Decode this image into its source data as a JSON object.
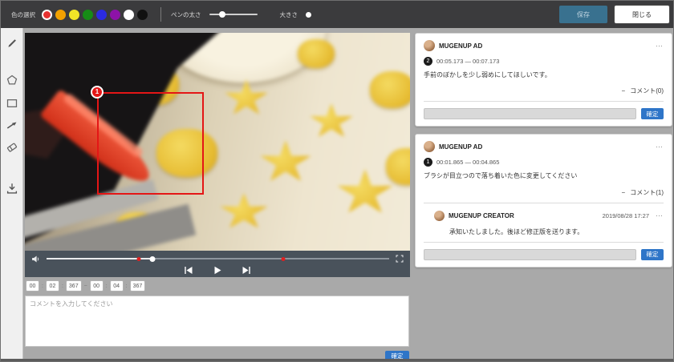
{
  "toolbar": {
    "color_label": "色の選択",
    "colors": [
      "#e53030",
      "#f2a100",
      "#f2e427",
      "#168c16",
      "#2b2be0",
      "#8d12a8",
      "#ffffff",
      "#111111"
    ],
    "selected_color_index": 0,
    "pen_width_label": "ペンの太さ",
    "size_label": "大きさ",
    "save_label": "保存",
    "close_label": "閉じる"
  },
  "player": {
    "annotation_badge": "1",
    "played_width": "31%",
    "markers": [
      "27%",
      "69%"
    ],
    "range_start": [
      "00",
      "02",
      "367"
    ],
    "range_end": [
      "00",
      "04",
      "367"
    ],
    "time_separator": ":",
    "range_separator": "−"
  },
  "comment_form": {
    "placeholder": "コメントを入力してください",
    "submit_label": "確定"
  },
  "icons": {
    "more": "⋯",
    "collapse": "−"
  },
  "comments": [
    {
      "author": "MUGENUP AD",
      "badge": "2",
      "time_range": "00:05.173 — 00:07.173",
      "body": "手前のぼかしを少し弱めにしてほしいです。",
      "comments_toggle": "コメント(0)",
      "reply_submit": "確定"
    },
    {
      "author": "MUGENUP AD",
      "badge": "1",
      "time_range": "00:01.865 — 00:04.865",
      "body": "ブラシが目立つので落ち着いた色に変更してください",
      "comments_toggle": "コメント(1)",
      "reply_submit": "確定",
      "replies": [
        {
          "author": "MUGENUP CREATOR",
          "date": "2019/08/28 17:27",
          "body": "承知いたしました。後ほど修正版を送ります。"
        }
      ]
    }
  ]
}
